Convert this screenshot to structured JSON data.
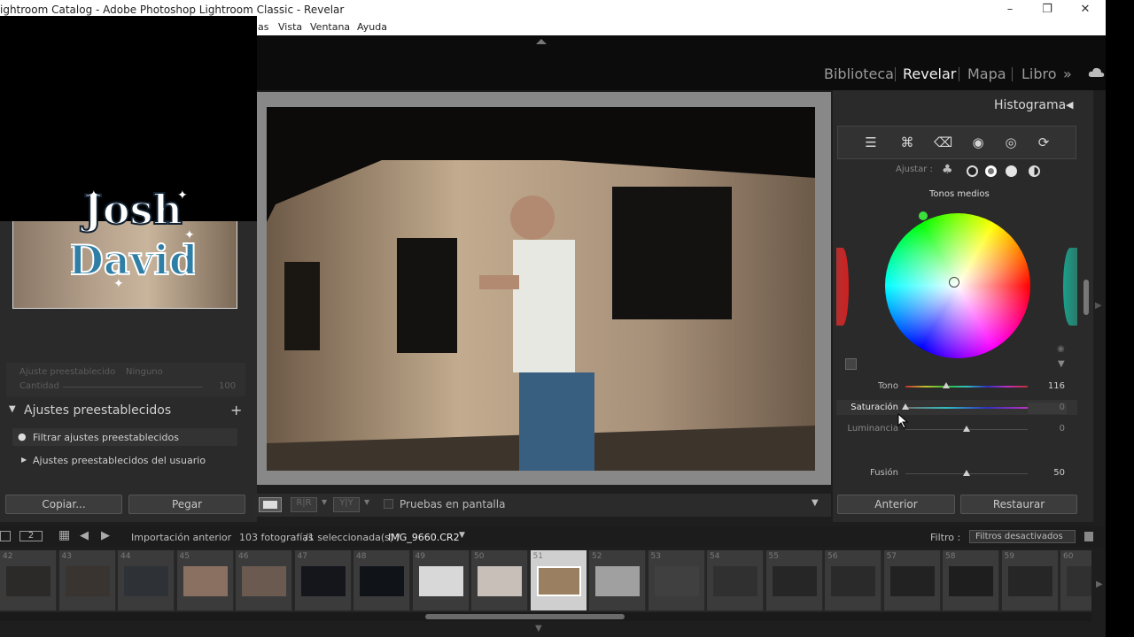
{
  "window": {
    "title": "ightroom Catalog - Adobe Photoshop Lightroom Classic - Revelar",
    "menu": [
      "as",
      "Vista",
      "Ventana",
      "Ayuda"
    ]
  },
  "modules": [
    "Biblioteca",
    "Revelar",
    "Mapa",
    "Libro"
  ],
  "active_module": "Revelar",
  "left_panel": {
    "logo_text": "Josh David",
    "preset_label": "Ajuste preestablecido",
    "preset_value": "Ninguno",
    "amount_label": "Cantidad",
    "amount_value": "100",
    "section_title": "Ajustes preestablecidos",
    "filter_placeholder": "Filtrar ajustes preestablecidos",
    "user_presets": "Ajustes preestablecidos del usuario",
    "copy_button": "Copiar...",
    "paste_button": "Pegar"
  },
  "toolbar": {
    "soft_proof_label": "Pruebas en pantalla"
  },
  "right_panel": {
    "histogram_title": "Histograma",
    "adjust_label": "Ajustar :",
    "wheel_title": "Tonos medios",
    "sliders": [
      {
        "label": "Tono",
        "value": "116",
        "pos": 0.33
      },
      {
        "label": "Saturación",
        "value": "0",
        "pos": 0.0
      },
      {
        "label": "Luminancia",
        "value": "0",
        "pos": 0.5
      }
    ],
    "blend": {
      "label": "Fusión",
      "value": "50",
      "pos": 0.5
    },
    "previous_button": "Anterior",
    "reset_button": "Restaurar"
  },
  "filmbar": {
    "source": "Importación anterior",
    "count": "103 fotografías",
    "selected": "/1 seleccionada(s) /",
    "filename": "IMG_9660.CR2",
    "filter_label": "Filtro :",
    "filter_value": "Filtros desactivados",
    "view_num": "2"
  },
  "filmstrip": [
    {
      "num": "42"
    },
    {
      "num": "43"
    },
    {
      "num": "44"
    },
    {
      "num": "45"
    },
    {
      "num": "46"
    },
    {
      "num": "47"
    },
    {
      "num": "48"
    },
    {
      "num": "49"
    },
    {
      "num": "50"
    },
    {
      "num": "51",
      "selected": true
    },
    {
      "num": "52"
    },
    {
      "num": "53"
    },
    {
      "num": "54"
    },
    {
      "num": "55"
    },
    {
      "num": "56"
    },
    {
      "num": "57"
    },
    {
      "num": "58"
    },
    {
      "num": "59"
    },
    {
      "num": "60"
    }
  ]
}
